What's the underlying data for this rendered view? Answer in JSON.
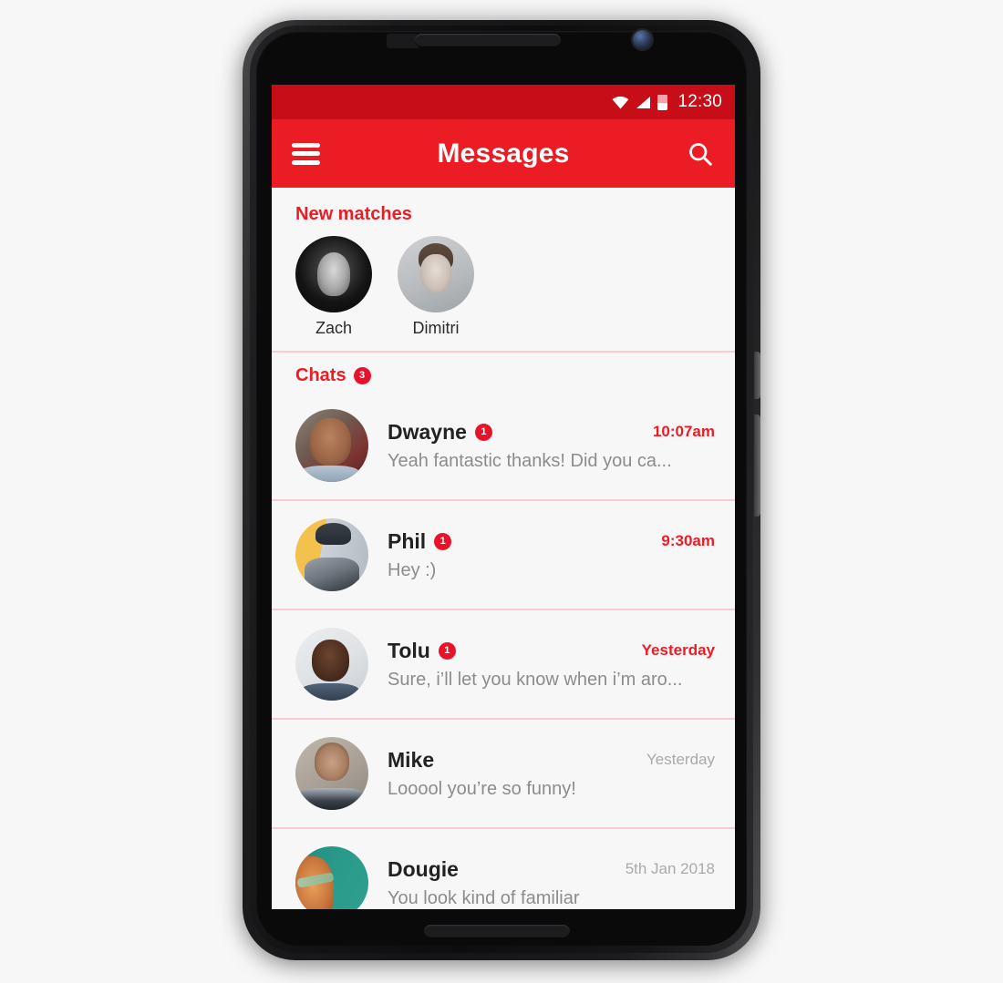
{
  "status_bar": {
    "time": "12:30",
    "icons": [
      "wifi-icon",
      "signal-icon",
      "battery-icon"
    ],
    "background_color": "#c70d18"
  },
  "app_bar": {
    "menu_icon": "hamburger-menu-icon",
    "title": "Messages",
    "search_icon": "search-icon",
    "background_color": "#ec1c24"
  },
  "new_matches": {
    "title": "New matches",
    "items": [
      {
        "name": "Zach",
        "avatar": "zach-avatar"
      },
      {
        "name": "Dimitri",
        "avatar": "dimitri-avatar"
      }
    ]
  },
  "chats": {
    "title": "Chats",
    "unread_count": "3",
    "rows": [
      {
        "name": "Dwayne",
        "badge": "1",
        "time": "10:07am",
        "unread": true,
        "preview": "Yeah fantastic thanks! Did you ca...",
        "avatar": "dwayne-avatar"
      },
      {
        "name": "Phil",
        "badge": "1",
        "time": "9:30am",
        "unread": true,
        "preview": "Hey :)",
        "avatar": "phil-avatar"
      },
      {
        "name": "Tolu",
        "badge": "1",
        "time": "Yesterday",
        "unread": true,
        "preview": "Sure, i’ll let you know when i’m aro...",
        "avatar": "tolu-avatar"
      },
      {
        "name": "Mike",
        "badge": "",
        "time": "Yesterday",
        "unread": false,
        "preview": "Looool you’re so funny!",
        "avatar": "mike-avatar"
      },
      {
        "name": "Dougie",
        "badge": "",
        "time": "5th Jan 2018",
        "unread": false,
        "preview": "You look kind of familiar",
        "avatar": "dougie-avatar"
      }
    ]
  },
  "theme": {
    "accent_red": "#ec1c24",
    "badge_red": "#e8122b",
    "divider_pink": "#f9ccd2",
    "screen_bg": "#f7f7f7",
    "preview_gray": "#8c8c8c",
    "read_time_gray": "#a9a9a9"
  },
  "device": {
    "earpiece": "earpiece-speaker",
    "front_camera": "front-camera",
    "bottom_speaker": "bottom-speaker",
    "power_button": "power-button",
    "volume_button": "volume-rocker-button"
  }
}
